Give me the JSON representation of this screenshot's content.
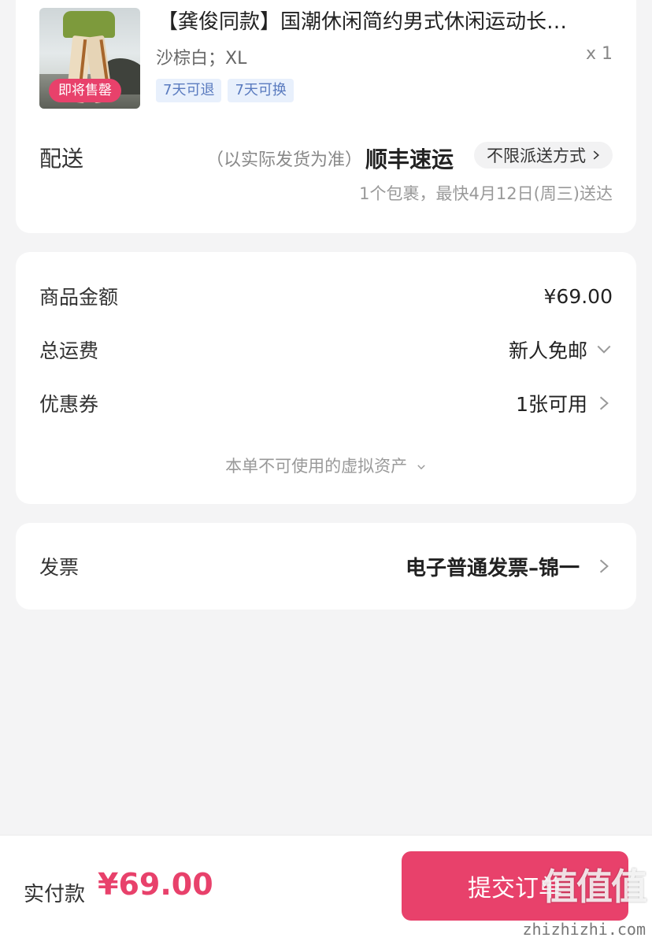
{
  "product": {
    "title": "【龚俊同款】国潮休闲简约男式休闲运动长…",
    "spec": "沙棕白；XL",
    "quantity": "x 1",
    "badge": "即将售罄",
    "tags": [
      "7天可退",
      "7天可换"
    ]
  },
  "shipping": {
    "label": "配送",
    "note": "（以实际发货为准）",
    "carrier": "顺丰速运",
    "method": "不限派送方式",
    "eta": "1个包裹，最快4月12日(周三)送达"
  },
  "price": {
    "goods_label": "商品金额",
    "goods_value": "¥69.00",
    "freight_label": "总运费",
    "freight_value": "新人免邮",
    "coupon_label": "优惠券",
    "coupon_value": "1张可用",
    "virtual_assets": "本单不可使用的虚拟资产"
  },
  "invoice": {
    "label": "发票",
    "value": "电子普通发票–锦一"
  },
  "footer": {
    "pay_label": "实付款",
    "pay_amount": "¥69.00",
    "submit_label": "提交订单",
    "watermark": "值值值",
    "watermark_url": "zhizhizhi.com"
  },
  "colors": {
    "accent": "#e8416b",
    "tag_text": "#5a7bbf",
    "tag_bg": "#e8f0fc",
    "background": "#f4f4f5"
  }
}
